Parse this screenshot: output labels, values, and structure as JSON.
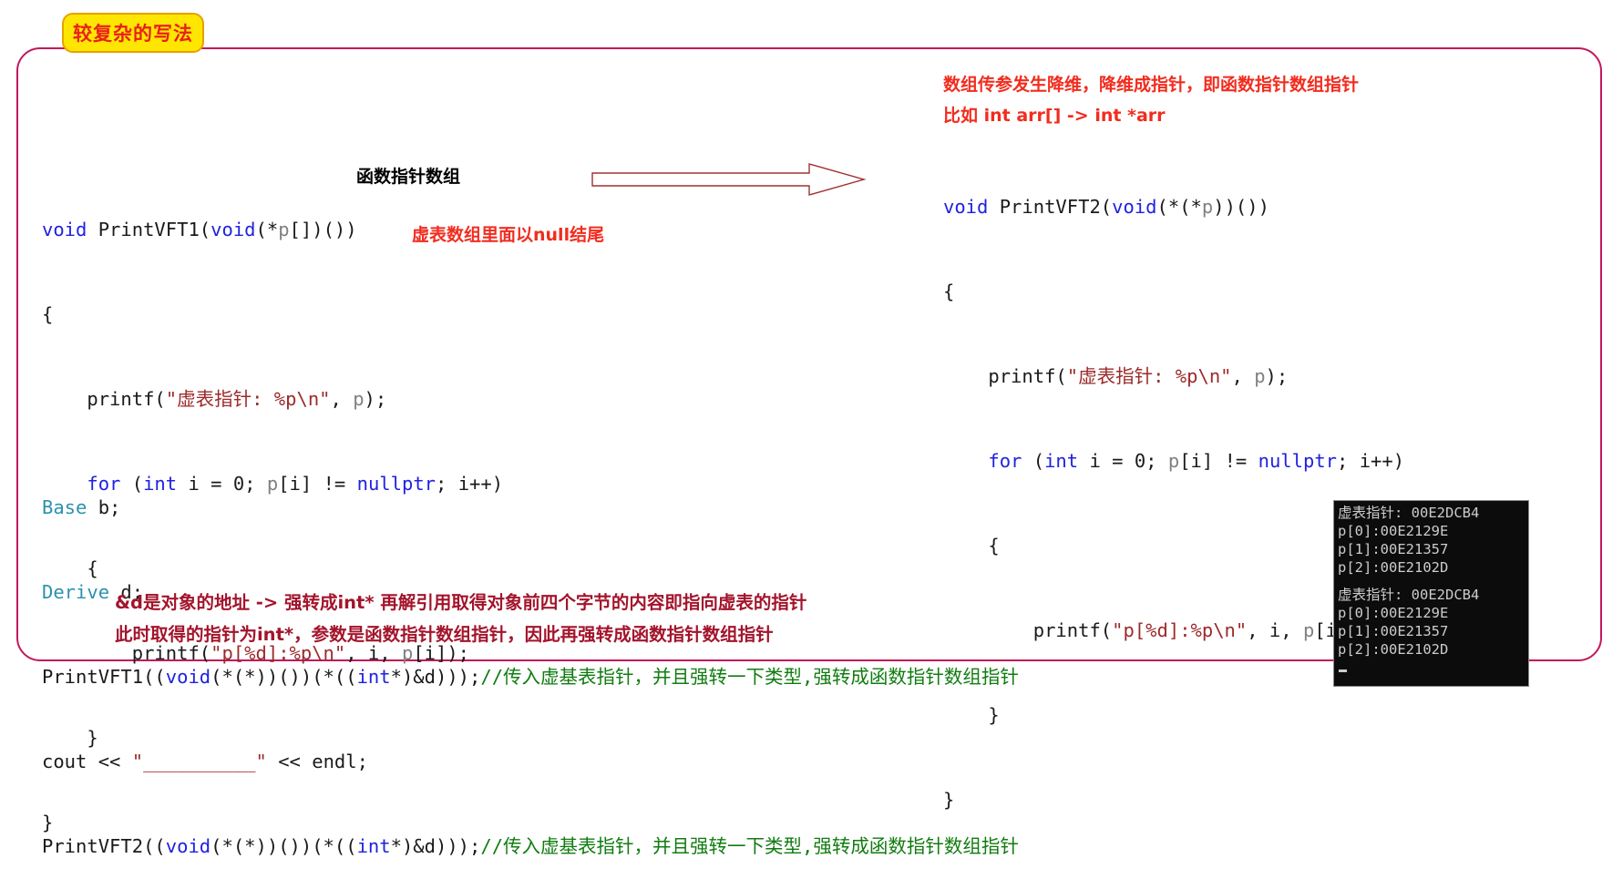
{
  "title_badge": {
    "text": "较复杂的写法"
  },
  "left_code": {
    "lines": [
      [
        {
          "t": "void",
          "c": "kw"
        },
        {
          "t": " PrintVFT1(",
          "c": "plain"
        },
        {
          "t": "void",
          "c": "kw"
        },
        {
          "t": "(*",
          "c": "plain"
        },
        {
          "t": "p",
          "c": "var"
        },
        {
          "t": "[])())",
          "c": "plain"
        }
      ],
      [
        {
          "t": "{",
          "c": "plain"
        }
      ],
      [
        {
          "t": "    printf(",
          "c": "plain"
        },
        {
          "t": "\"虚表指针: %p\\n\"",
          "c": "str"
        },
        {
          "t": ", ",
          "c": "plain"
        },
        {
          "t": "p",
          "c": "var"
        },
        {
          "t": ");",
          "c": "plain"
        }
      ],
      [
        {
          "t": "    ",
          "c": "plain"
        },
        {
          "t": "for",
          "c": "kw"
        },
        {
          "t": " (",
          "c": "plain"
        },
        {
          "t": "int",
          "c": "kw"
        },
        {
          "t": " i = 0; ",
          "c": "plain"
        },
        {
          "t": "p",
          "c": "var"
        },
        {
          "t": "[i] != ",
          "c": "plain"
        },
        {
          "t": "nullptr",
          "c": "kw"
        },
        {
          "t": "; i++)",
          "c": "plain"
        }
      ],
      [
        {
          "t": "    {",
          "c": "plain"
        }
      ],
      [
        {
          "t": "        printf(",
          "c": "plain"
        },
        {
          "t": "\"p[%d]:%p\\n\"",
          "c": "str"
        },
        {
          "t": ", i, ",
          "c": "plain"
        },
        {
          "t": "p",
          "c": "var"
        },
        {
          "t": "[i]);",
          "c": "plain"
        }
      ],
      [
        {
          "t": "    }",
          "c": "plain"
        }
      ],
      [
        {
          "t": "}",
          "c": "plain"
        }
      ]
    ]
  },
  "right_code": {
    "lines": [
      [
        {
          "t": "void",
          "c": "kw"
        },
        {
          "t": " PrintVFT2(",
          "c": "plain"
        },
        {
          "t": "void",
          "c": "kw"
        },
        {
          "t": "(*(*",
          "c": "plain"
        },
        {
          "t": "p",
          "c": "var"
        },
        {
          "t": "))())",
          "c": "plain"
        }
      ],
      [
        {
          "t": "{",
          "c": "plain"
        }
      ],
      [
        {
          "t": "    printf(",
          "c": "plain"
        },
        {
          "t": "\"虚表指针: %p\\n\"",
          "c": "str"
        },
        {
          "t": ", ",
          "c": "plain"
        },
        {
          "t": "p",
          "c": "var"
        },
        {
          "t": ");",
          "c": "plain"
        }
      ],
      [
        {
          "t": "    ",
          "c": "plain"
        },
        {
          "t": "for",
          "c": "kw"
        },
        {
          "t": " (",
          "c": "plain"
        },
        {
          "t": "int",
          "c": "kw"
        },
        {
          "t": " i = 0; ",
          "c": "plain"
        },
        {
          "t": "p",
          "c": "var"
        },
        {
          "t": "[i] != ",
          "c": "plain"
        },
        {
          "t": "nullptr",
          "c": "kw"
        },
        {
          "t": "; i++)",
          "c": "plain"
        }
      ],
      [
        {
          "t": "    {",
          "c": "plain"
        }
      ],
      [
        {
          "t": "        printf(",
          "c": "plain"
        },
        {
          "t": "\"p[%d]:%p\\n\"",
          "c": "str"
        },
        {
          "t": ", i, ",
          "c": "plain"
        },
        {
          "t": "p",
          "c": "var"
        },
        {
          "t": "[i]);",
          "c": "plain"
        }
      ],
      [
        {
          "t": "    }",
          "c": "plain"
        }
      ],
      [
        {
          "t": "}",
          "c": "plain"
        }
      ]
    ]
  },
  "bottom_code": {
    "lines": [
      [
        {
          "t": "Base",
          "c": "cls"
        },
        {
          "t": " b;",
          "c": "plain"
        }
      ],
      [
        {
          "t": "Derive",
          "c": "cls"
        },
        {
          "t": " d;",
          "c": "plain"
        }
      ],
      [
        {
          "t": "PrintVFT1((",
          "c": "plain"
        },
        {
          "t": "void",
          "c": "kw"
        },
        {
          "t": "(*(*))())(*((",
          "c": "plain"
        },
        {
          "t": "int",
          "c": "kw"
        },
        {
          "t": "*)&d)));",
          "c": "plain"
        },
        {
          "t": "//传入虚基表指针，并且强转一下类型,强转成函数指针数组指针",
          "c": "cmt"
        }
      ],
      [
        {
          "t": "cout << ",
          "c": "plain"
        },
        {
          "t": "\"__________\"",
          "c": "str"
        },
        {
          "t": " << endl;",
          "c": "plain"
        }
      ],
      [
        {
          "t": "PrintVFT2((",
          "c": "plain"
        },
        {
          "t": "void",
          "c": "kw"
        },
        {
          "t": "(*(*))())(*((",
          "c": "plain"
        },
        {
          "t": "int",
          "c": "kw"
        },
        {
          "t": "*)&d)));",
          "c": "plain"
        },
        {
          "t": "//传入虚基表指针，并且强转一下类型,强转成函数指针数组指针",
          "c": "cmt"
        }
      ]
    ]
  },
  "labels": {
    "func_ptr_array": "函数指针数组",
    "null_terminated": "虚表数组里面以null结尾"
  },
  "top_right_notes": {
    "line1": "数组传参发生降维，降维成指针，即函数指针数组指针",
    "line2": "比如 int arr[] -> int *arr"
  },
  "bottom_notes": {
    "line1": "&d是对象的地址 -> 强转成int* 再解引用取得对象前四个字节的内容即指向虚表的指针",
    "line2": "此时取得的指针为int*，参数是函数指针数组指针，因此再强转成函数指针数组指针"
  },
  "console": {
    "block1": [
      "虚表指针: 00E2DCB4",
      "p[0]:00E2129E",
      "p[1]:00E21357",
      "p[2]:00E2102D"
    ],
    "block2": [
      "虚表指针: 00E2DCB4",
      "p[0]:00E2129E",
      "p[1]:00E21357",
      "p[2]:00E2102D"
    ]
  },
  "colors": {
    "panel_border": "#c2185b",
    "badge_bg": "#ffe600",
    "badge_border": "#e8a000",
    "badge_text": "#e8201a",
    "annotation_red": "#f22c1e",
    "annotation_crimson": "#a3142b",
    "keyword": "#1f22e0",
    "string": "#9c2a2a",
    "comment": "#107c10",
    "classname": "#2b91af",
    "arrow": "#a03030",
    "console_bg": "#0c0c0c",
    "console_text": "#cccccc"
  }
}
